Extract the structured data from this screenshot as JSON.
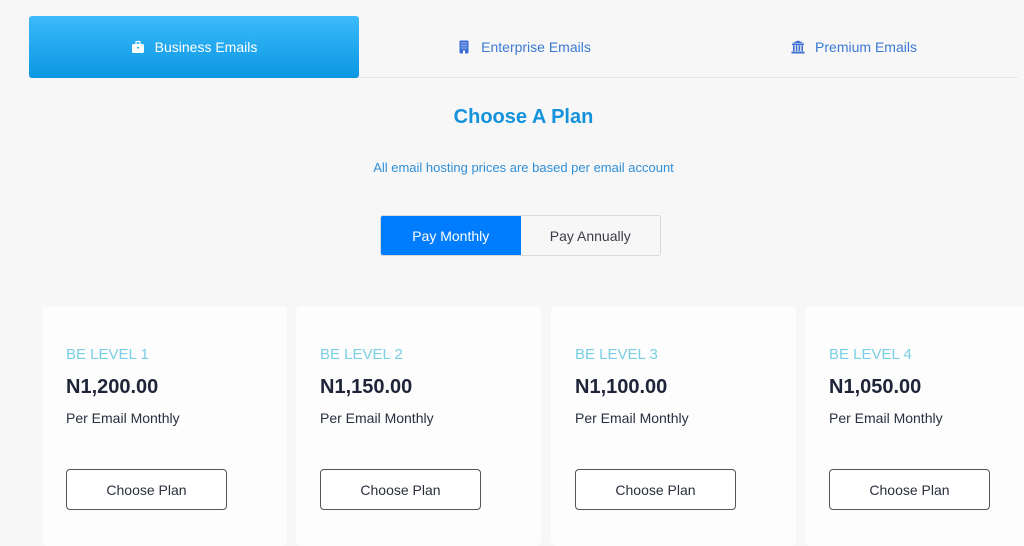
{
  "tabs": [
    {
      "label": "Business Emails",
      "icon": "briefcase-icon",
      "active": true
    },
    {
      "label": "Enterprise Emails",
      "icon": "building-icon",
      "active": false
    },
    {
      "label": "Premium Emails",
      "icon": "bank-icon",
      "active": false
    }
  ],
  "header": {
    "title": "Choose A Plan",
    "subtitle": "All email hosting prices are based per email account"
  },
  "billing_toggle": {
    "monthly": "Pay Monthly",
    "annually": "Pay Annually",
    "selected": "monthly"
  },
  "plans": [
    {
      "level": "BE LEVEL 1",
      "price": "N1,200.00",
      "period": "Per Email Monthly",
      "button": "Choose Plan"
    },
    {
      "level": "BE LEVEL 2",
      "price": "N1,150.00",
      "period": "Per Email Monthly",
      "button": "Choose Plan"
    },
    {
      "level": "BE LEVEL 3",
      "price": "N1,100.00",
      "period": "Per Email Monthly",
      "button": "Choose Plan"
    },
    {
      "level": "BE LEVEL 4",
      "price": "N1,050.00",
      "period": "Per Email Monthly",
      "button": "Choose Plan"
    }
  ],
  "colors": {
    "accent": "#007cff",
    "tab_active": "#0a97e2",
    "title": "#1492db",
    "level": "#79cfe3"
  }
}
